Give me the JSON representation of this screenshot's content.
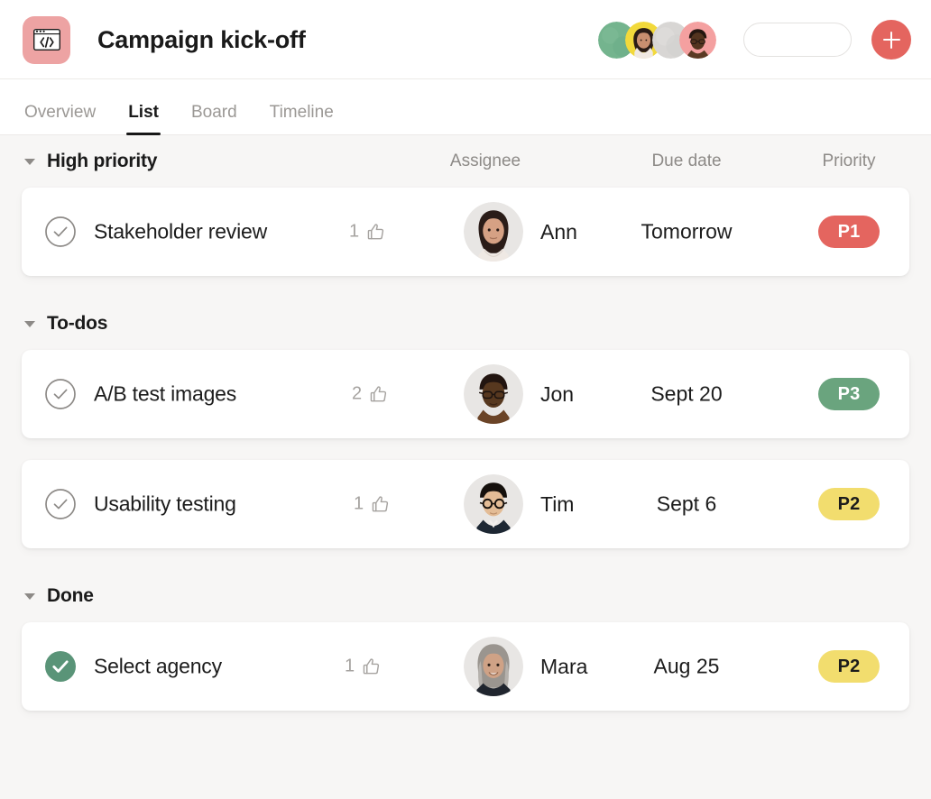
{
  "header": {
    "project_icon": "code-window-icon",
    "project_icon_bg": "#eda3a3",
    "title": "Campaign kick-off",
    "members": [
      {
        "name": "member-avatar-1",
        "bg": "#74b48e",
        "type": "blank"
      },
      {
        "name": "member-avatar-2",
        "bg": "#f2d93b",
        "type": "woman-dark-hair"
      },
      {
        "name": "member-avatar-3",
        "bg": "#d8d6d4",
        "type": "blank"
      },
      {
        "name": "member-avatar-4",
        "bg": "#f4a0a0",
        "type": "man-glasses"
      }
    ],
    "search_pill_value": "",
    "search_pill_placeholder": "",
    "add_button_label": "+",
    "add_button_color": "#e4655f"
  },
  "tabs": [
    {
      "label": "Overview",
      "active": false
    },
    {
      "label": "List",
      "active": true
    },
    {
      "label": "Board",
      "active": false
    },
    {
      "label": "Timeline",
      "active": false
    }
  ],
  "columns": {
    "assignee": "Assignee",
    "due_date": "Due date",
    "priority": "Priority"
  },
  "priority_colors": {
    "P1": {
      "bg": "#e4655f",
      "fg": "#ffffff"
    },
    "P2": {
      "bg": "#f2dd6e",
      "fg": "#1c1c1c"
    },
    "P3": {
      "bg": "#6aa47e",
      "fg": "#ffffff"
    }
  },
  "sections": [
    {
      "title": "High priority",
      "collapsed": false,
      "tasks": [
        {
          "name": "Stakeholder review",
          "done": false,
          "likes": "1",
          "assignee": "Ann",
          "avatar": "woman-dark-hair",
          "due_date": "Tomorrow",
          "priority": "P1"
        }
      ]
    },
    {
      "title": "To-dos",
      "collapsed": false,
      "tasks": [
        {
          "name": "A/B test images",
          "done": false,
          "likes": "2",
          "assignee": "Jon",
          "avatar": "man-glasses",
          "due_date": "Sept 20",
          "priority": "P3"
        },
        {
          "name": "Usability testing",
          "done": false,
          "likes": "1",
          "assignee": "Tim",
          "avatar": "man-round-glasses",
          "due_date": "Sept 6",
          "priority": "P2"
        }
      ]
    },
    {
      "title": "Done",
      "collapsed": false,
      "tasks": [
        {
          "name": "Select agency",
          "done": true,
          "likes": "1",
          "assignee": "Mara",
          "avatar": "woman-gray-hair",
          "due_date": "Aug 25",
          "priority": "P2"
        }
      ]
    }
  ]
}
